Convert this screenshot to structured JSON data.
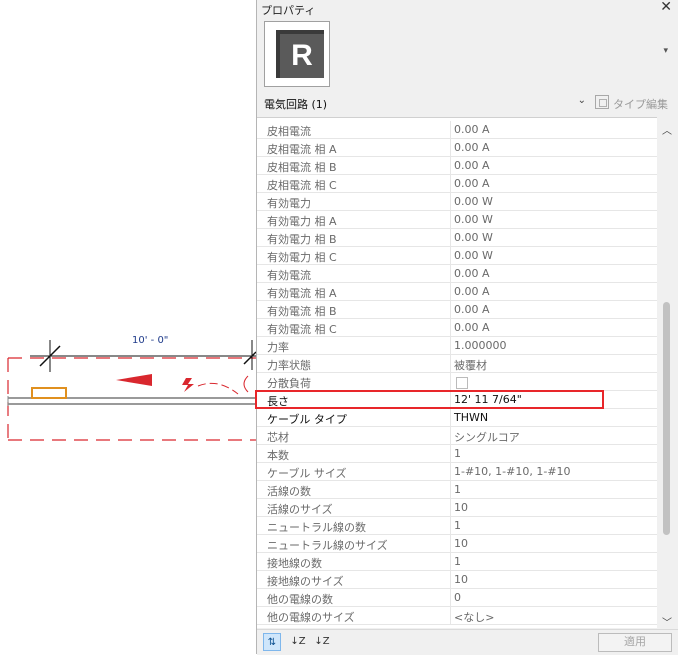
{
  "canvas": {
    "dimension_text": "10' - 0\""
  },
  "panel": {
    "title": "プロパティ",
    "close_glyph": "✕",
    "type_dropdown_glyph": "▾",
    "selector_label": "電気回路 (1)",
    "selector_arrow": "⌄",
    "type_edit_label": "タイプ編集",
    "apply_label": "適用",
    "bottom_icons": [
      "⇅",
      "↓Z",
      "↓Z"
    ],
    "properties": [
      {
        "name": "皮相電流",
        "value": "0.00 A"
      },
      {
        "name": "皮相電流 相 A",
        "value": "0.00 A"
      },
      {
        "name": "皮相電流 相 B",
        "value": "0.00 A"
      },
      {
        "name": "皮相電流 相 C",
        "value": "0.00 A"
      },
      {
        "name": "有効電力",
        "value": "0.00 W"
      },
      {
        "name": "有効電力 相 A",
        "value": "0.00 W"
      },
      {
        "name": "有効電力 相 B",
        "value": "0.00 W"
      },
      {
        "name": "有効電力 相 C",
        "value": "0.00 W"
      },
      {
        "name": "有効電流",
        "value": "0.00 A"
      },
      {
        "name": "有効電流 相 A",
        "value": "0.00 A"
      },
      {
        "name": "有効電流 相 B",
        "value": "0.00 A"
      },
      {
        "name": "有効電流 相 C",
        "value": "0.00 A"
      },
      {
        "name": "力率",
        "value": "1.000000"
      },
      {
        "name": "力率状態",
        "value": "被覆材"
      },
      {
        "name": "分散負荷",
        "value": ""
      },
      {
        "name": "長さ",
        "value": "12'  11 7/64\""
      },
      {
        "name": "ケーブル タイプ",
        "value": "THWN"
      },
      {
        "name": "芯材",
        "value": "シングルコア"
      },
      {
        "name": "本数",
        "value": "1"
      },
      {
        "name": "ケーブル サイズ",
        "value": "1-#10, 1-#10, 1-#10"
      },
      {
        "name": "活線の数",
        "value": "1"
      },
      {
        "name": "活線のサイズ",
        "value": "10"
      },
      {
        "name": "ニュートラル線の数",
        "value": "1"
      },
      {
        "name": "ニュートラル線のサイズ",
        "value": "10"
      },
      {
        "name": "接地線の数",
        "value": "1"
      },
      {
        "name": "接地線のサイズ",
        "value": "10"
      },
      {
        "name": "他の電線の数",
        "value": "0"
      },
      {
        "name": "他の電線のサイズ",
        "value": "<なし>"
      }
    ]
  },
  "colors": {
    "highlight": "#e8262a",
    "circuit_red": "#d9272e",
    "device_orange": "#e0901f",
    "dimension_blue": "#1f3b8a"
  }
}
